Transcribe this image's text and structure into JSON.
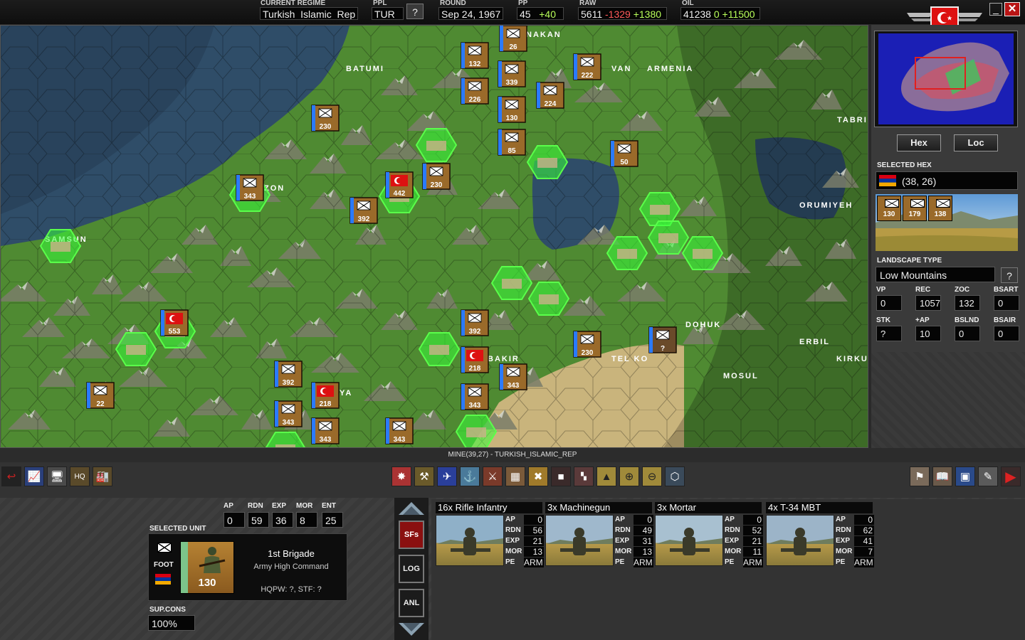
{
  "topbar": {
    "regime_label": "CURRENT REGIME",
    "regime_value": "Turkish_Islamic_Rep",
    "ppl_label": "PPL",
    "ppl_value": "TUR",
    "help_button": "?",
    "round_label": "ROUND",
    "round_value": "Sep 24, 1967",
    "pp_label": "PP",
    "pp_value": "45",
    "pp_delta": "+40",
    "raw_label": "RAW",
    "raw_value": "5611",
    "raw_minus": "-1329",
    "raw_plus": "+1380",
    "oil_label": "OIL",
    "oil_value": "41238",
    "oil_zero": "0",
    "oil_plus": "+11500"
  },
  "map": {
    "cities": [
      "BATUMI",
      "NAKAN",
      "VAN",
      "ARMENIA",
      "TABRI",
      "ZON",
      "SAMSUN",
      "ORUMIYEH",
      "DOHUK",
      "ERBIL",
      "KIRKU",
      "MOSUL",
      "BAKIR",
      "TEL KO",
      "YA"
    ],
    "units": [
      {
        "value": "26"
      },
      {
        "value": "132"
      },
      {
        "value": "339"
      },
      {
        "value": "222"
      },
      {
        "value": "226"
      },
      {
        "value": "224"
      },
      {
        "value": "130"
      },
      {
        "value": "230"
      },
      {
        "value": "85"
      },
      {
        "value": "50"
      },
      {
        "value": "230"
      },
      {
        "value": "343"
      },
      {
        "value": "442"
      },
      {
        "value": "392"
      },
      {
        "value": "553"
      },
      {
        "value": "392"
      },
      {
        "value": "218"
      },
      {
        "value": "230"
      },
      {
        "value": "?"
      },
      {
        "value": "343"
      },
      {
        "value": "392"
      },
      {
        "value": "218"
      },
      {
        "value": "343"
      },
      {
        "value": "343"
      },
      {
        "value": "22"
      },
      {
        "value": "343"
      },
      {
        "value": "343"
      }
    ],
    "status_text": "MINE(39,27) - TURKISH_ISLAMIC_REP"
  },
  "right_panel": {
    "hex_button": "Hex",
    "loc_button": "Loc",
    "selected_hex_label": "SELECTED HEX",
    "selected_hex_coords": "(38, 26)",
    "hex_units": [
      "130",
      "179",
      "138"
    ],
    "landscape_label": "LANDSCAPE TYPE",
    "landscape_value": "Low Mountains",
    "landscape_help": "?",
    "stats": [
      {
        "label": "VP",
        "value": "0"
      },
      {
        "label": "REC",
        "value": "1057"
      },
      {
        "label": "ZOC",
        "value": "132"
      },
      {
        "label": "BSART",
        "value": "0"
      },
      {
        "label": "STK",
        "value": "?"
      },
      {
        "label": "+AP",
        "value": "10"
      },
      {
        "label": "BSLND",
        "value": "0"
      },
      {
        "label": "BSAIR",
        "value": "0"
      }
    ]
  },
  "toolbar": {
    "hq_label": "HQ"
  },
  "selected_unit": {
    "section_label": "SELECTED UNIT",
    "stats": [
      {
        "label": "AP",
        "value": "0"
      },
      {
        "label": "RDN",
        "value": "59"
      },
      {
        "label": "EXP",
        "value": "36"
      },
      {
        "label": "MOR",
        "value": "8"
      },
      {
        "label": "ENT",
        "value": "25"
      }
    ],
    "type": "FOOT",
    "size": "130",
    "name": "1st Brigade",
    "hq": "Army High Command",
    "hqpw": "HQPW: ?, STF: ?",
    "supcons_label": "SUP.CONS",
    "supcons_value": "100%",
    "side_buttons": [
      "SFs",
      "LOG",
      "ANL"
    ]
  },
  "subformations": [
    {
      "title": "16x Rifle Infantry",
      "AP": "0",
      "RDN": "56",
      "EXP": "21",
      "MOR": "13",
      "PE": "ARM"
    },
    {
      "title": "3x Machinegun",
      "AP": "0",
      "RDN": "49",
      "EXP": "31",
      "MOR": "13",
      "PE": "ARM"
    },
    {
      "title": "3x Mortar",
      "AP": "0",
      "RDN": "52",
      "EXP": "21",
      "MOR": "11",
      "PE": "ARM"
    },
    {
      "title": "4x T-34 MBT",
      "AP": "0",
      "RDN": "62",
      "EXP": "41",
      "MOR": "7",
      "PE": "ARM"
    }
  ],
  "colors": {
    "sea": "#2f4d68",
    "land": "#4f8a32",
    "desert": "#c9b47c",
    "unit": "#9a6a2a",
    "highlight": "#38ff3a"
  }
}
